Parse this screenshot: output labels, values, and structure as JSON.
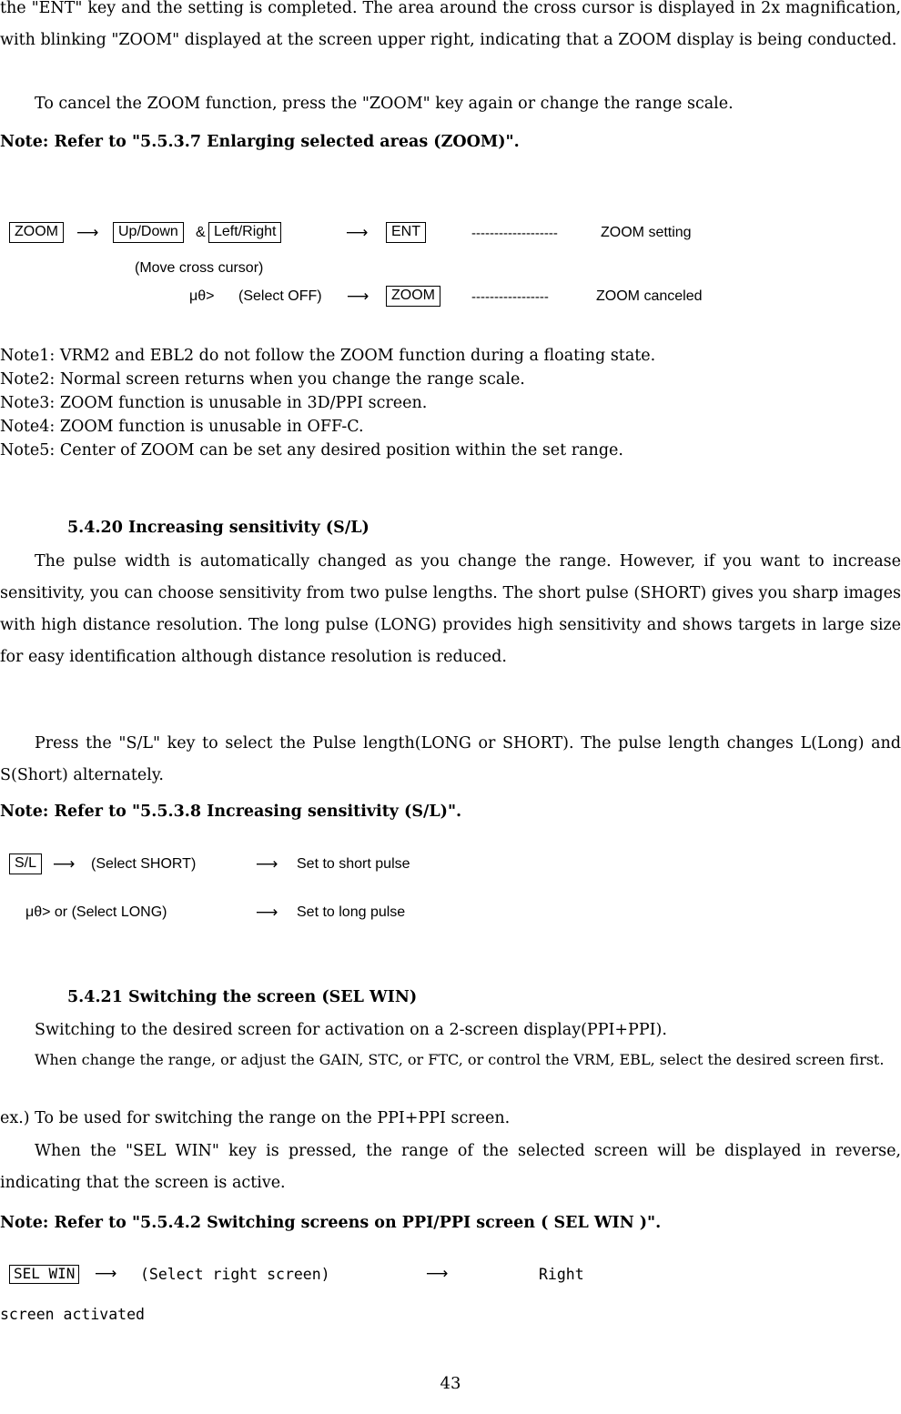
{
  "document": {
    "page_number": "43",
    "paragraphs": {
      "zoom_intro": "the \"ENT\" key and the setting is completed.  The area around the cross cursor is displayed in 2x magnification, with blinking \"ZOOM\" displayed at the screen upper right, indicating that a ZOOM display is being conducted.",
      "zoom_cancel": "To cancel the ZOOM function, press the \"ZOOM\" key again or change the range scale.",
      "zoom_note_ref": "Note: Refer to \"5.5.3.7 Enlarging selected areas (ZOOM)\".",
      "sl_para1": "The pulse width is automatically changed as you change the range. However, if you want to increase sensitivity, you can choose sensitivity from two pulse lengths. The short pulse (SHORT) gives you sharp images with high distance resolution. The long pulse (LONG) provides high sensitivity and shows targets in large size for easy identification although distance resolution is reduced.",
      "sl_para2": "Press the \"S/L\" key to select the Pulse length(LONG or SHORT). The pulse length changes L(Long) and S(Short) alternately.",
      "sl_note_ref": "Note: Refer to \"5.5.3.8 Increasing sensitivity (S/L)\".",
      "selwin_para1": "Switching to the desired screen for activation on a 2-screen display(PPI+PPI).",
      "selwin_para2": "When change the range, or adjust the GAIN, STC, or FTC, or control the VRM, EBL, select the desired screen first.",
      "selwin_para3": "ex.)  To be used for switching the range on the PPI+PPI screen.",
      "selwin_para4": "When the \"SEL WIN\" key  is pressed, the range of the selected screen will be displayed in reverse, indicating that the screen is active.",
      "selwin_note_ref": "Note: Refer to \"5.5.4.2 Switching screens on PPI/PPI screen ( SEL WIN )\"."
    },
    "zoom_diagram": {
      "key_zoom": "ZOOM",
      "arrow1": "⟶",
      "key_updown": "Up/Down",
      "ampersand": "&",
      "key_leftright": "Left/Right",
      "arrow2": "⟶",
      "key_ent": "ENT",
      "dashes1": "-------------------",
      "label_zoom_setting": "ZOOM setting",
      "move_cursor": "(Move cross cursor)",
      "mu_theta": "μθ>",
      "select_off": "(Select OFF)",
      "arrow3": "⟶",
      "key_zoom2": "ZOOM",
      "dashes2": "-----------------",
      "label_zoom_canceled": "ZOOM canceled"
    },
    "zoom_notes": [
      "Note1: VRM2 and EBL2 do not follow the ZOOM function during a floating state.",
      "Note2: Normal screen returns when you change the range scale.",
      "Note3: ZOOM function is unusable in 3D/PPI screen.",
      "Note4: ZOOM function is unusable in OFF-C.",
      "Note5: Center of ZOOM can be set any desired position within the set range."
    ],
    "sections": {
      "s5420": "5.4.20 Increasing sensitivity (S/L)",
      "s5421": "5.4.21 Switching the screen (SEL WIN)"
    },
    "sl_diagram": {
      "key_sl": "S/L",
      "arrow1": "⟶",
      "select_short": "(Select SHORT)",
      "arrow2": "⟶",
      "set_short": "Set to short pulse",
      "mu_theta_long": "μθ> or (Select LONG)",
      "arrow3": "⟶",
      "set_long": "Set to long pulse"
    },
    "selwin_diagram": {
      "key_selwin": "SEL WIN",
      "arrow1": "⟶",
      "select_right": "(Select right screen)",
      "arrow2": "⟶",
      "right_label": "Right",
      "screen_activated": "screen activated"
    }
  }
}
